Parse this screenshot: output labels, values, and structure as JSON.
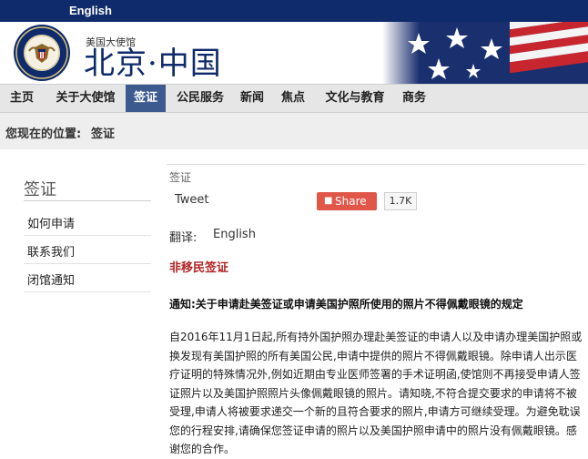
{
  "topbar": {
    "language_link": "English"
  },
  "banner": {
    "embassy_small": "美国大使馆",
    "embassy_big": "北京·中国",
    "seal_text": "UNITED STATES OF AMERICA · EMBASSY"
  },
  "nav": {
    "items": [
      {
        "label": "主页"
      },
      {
        "label": "关于大使馆"
      },
      {
        "label": "签证"
      },
      {
        "label": "公民服务"
      },
      {
        "label": "新闻"
      },
      {
        "label": "焦点"
      },
      {
        "label": "文化与教育"
      },
      {
        "label": "商务"
      }
    ],
    "active": "签证"
  },
  "breadcrumb": {
    "prefix": "您现在的位置:",
    "current": "签证"
  },
  "sidebar": {
    "title": "签证",
    "items": [
      {
        "label": "如何申请"
      },
      {
        "label": "联系我们"
      },
      {
        "label": "闭馆通知"
      }
    ]
  },
  "main": {
    "section_label": "签证",
    "tweet_label": "Tweet",
    "share_label": "Share",
    "share_count": "1.7K",
    "translate_label": "翻译:",
    "translate_value": "English",
    "red_title": "非移民签证",
    "notice_title": "通知:关于申请赴美签证或申请美国护照所使用的照片不得佩戴眼镜的规定",
    "body": "自2016年11月1日起,所有持外国护照办理赴美签证的申请人以及申请办理美国护照或换发现有美国护照的所有美国公民,申请中提供的照片不得佩戴眼镜。除申请人出示医疗证明的特殊情况外,例如近期由专业医师签署的手术证明函,使馆则不再接受申请人签证照片以及美国护照照片头像佩戴眼镜的照片。请知晓,不符合提交要求的申请将不被受理,申请人将被要求递交一个新的且符合要求的照片,申请方可继续受理。为避免耽误您的行程安排,请确保您签证申请的照片以及美国护照申请中的照片没有佩戴眼镜。感谢您的合作。"
  },
  "colors": {
    "topbar": "#0f2b6b",
    "nav_active": "#3d5a8e",
    "share": "#e0574a",
    "red_title": "#b22222"
  },
  "icons": [
    "embassy-seal",
    "us-flag",
    "share-icon"
  ]
}
